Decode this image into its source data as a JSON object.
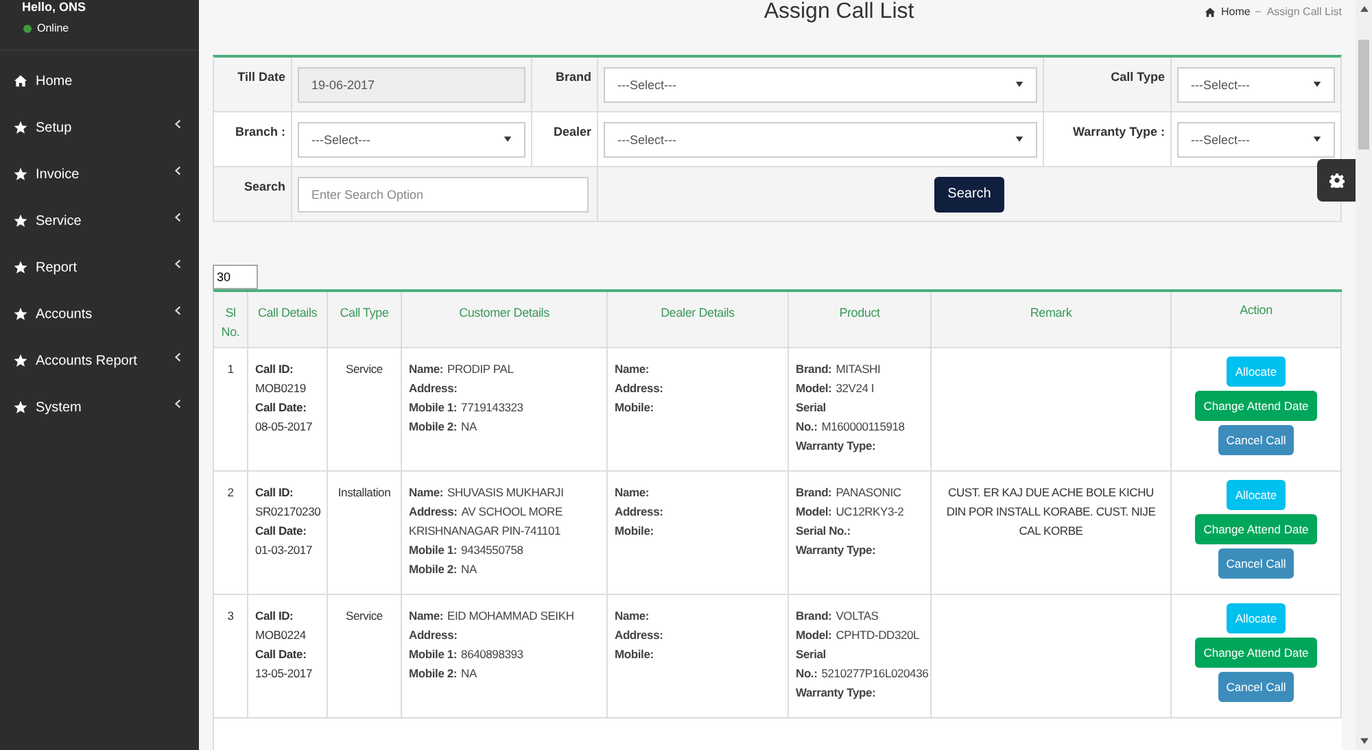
{
  "sidebar": {
    "user": "Hello, ONS",
    "status": "Online",
    "items": [
      {
        "label": "Home",
        "kind": "home",
        "expandable": false
      },
      {
        "label": "Setup",
        "kind": "star",
        "expandable": true
      },
      {
        "label": "Invoice",
        "kind": "star",
        "expandable": true
      },
      {
        "label": "Service",
        "kind": "star",
        "expandable": true
      },
      {
        "label": "Report",
        "kind": "star",
        "expandable": true
      },
      {
        "label": "Accounts",
        "kind": "star",
        "expandable": true
      },
      {
        "label": "Accounts Report",
        "kind": "star",
        "expandable": true
      },
      {
        "label": "System",
        "kind": "star",
        "expandable": true
      }
    ]
  },
  "page": {
    "title": "Assign Call List",
    "breadcrumb": [
      "Home",
      "Assign Call List"
    ]
  },
  "filter_rows": [
    [
      {
        "kind": "label",
        "text": "Till Date"
      },
      {
        "kind": "date",
        "value": "19-06-2017"
      },
      {
        "kind": "label",
        "text": "Brand"
      },
      {
        "kind": "select",
        "value": "---Select---"
      },
      {
        "kind": "label",
        "text": "Call Type"
      },
      {
        "kind": "select",
        "value": "---Select---"
      }
    ],
    [
      {
        "kind": "label",
        "text": "Branch :"
      },
      {
        "kind": "select",
        "value": "---Select---"
      },
      {
        "kind": "label",
        "text": "Dealer"
      },
      {
        "kind": "select",
        "value": "---Select---"
      },
      {
        "kind": "label",
        "text": "Warranty Type :"
      },
      {
        "kind": "select",
        "value": "---Select---"
      }
    ],
    [
      {
        "kind": "label",
        "text": "Search"
      },
      {
        "kind": "search",
        "placeholder": "Enter Search Option"
      },
      {
        "kind": "button",
        "text": "Search"
      }
    ]
  ],
  "page_size": "30",
  "table": {
    "columns": [
      "Sl No.",
      "Call Details",
      "Call Type",
      "Customer Details",
      "Dealer Details",
      "Product",
      "Remark",
      "Action"
    ],
    "rows": [
      {
        "sl": "1",
        "call": [
          {
            "label": "Call ID:",
            "value": "MOB0219"
          },
          {
            "label": "Call Date:",
            "value": "08-05-2017"
          }
        ],
        "call_type": "Service",
        "customer": [
          {
            "label": "Name:",
            "value": "PRODIP PAL"
          },
          {
            "label": "Address:"
          },
          {
            "label": "Mobile 1:",
            "value": "7719143323"
          },
          {
            "label": "Mobile 2:",
            "value": "NA"
          }
        ],
        "dealer": [
          {
            "label": "Name:"
          },
          {
            "label": "Address:"
          },
          {
            "label": "Mobile:"
          }
        ],
        "product": [
          {
            "label": "Brand:",
            "value": "MITASHI"
          },
          {
            "label": "Model:",
            "value": "32V24 I"
          },
          {
            "label": "Serial No.:",
            "value": "M160000115918"
          },
          {
            "label": "Warranty Type:"
          }
        ],
        "actions": [
          {
            "label": "Allocate",
            "kind": "allocate"
          },
          {
            "label": "Change Attend Date",
            "kind": "change"
          },
          {
            "label": "Cancel Call",
            "kind": "cancel"
          }
        ]
      },
      {
        "sl": "2",
        "call": [
          {
            "label": "Call ID:",
            "value": "SR02170230"
          },
          {
            "label": "Call Date:",
            "value": "01-03-2017"
          }
        ],
        "call_type": "Installation",
        "customer": [
          {
            "label": "Name:",
            "value": "SHUVASIS MUKHARJI"
          },
          {
            "label": "Address:",
            "value": "AV SCHOOL MORE KRISHNANAGAR PIN-741101"
          },
          {
            "label": "Mobile 1:",
            "value": "9434550758"
          },
          {
            "label": "Mobile 2:",
            "value": "NA"
          }
        ],
        "dealer": [
          {
            "label": "Name:"
          },
          {
            "label": "Address:"
          },
          {
            "label": "Mobile:"
          }
        ],
        "product": [
          {
            "label": "Brand:",
            "value": "PANASONIC"
          },
          {
            "label": "Model:",
            "value": "UC12RKY3-2"
          },
          {
            "label": "Serial No.:"
          },
          {
            "label": "Warranty Type:"
          }
        ],
        "remark": "CUST. ER KAJ DUE ACHE BOLE KICHU DIN POR INSTALL KORABE. CUST. NIJE CAL KORBE",
        "actions": [
          {
            "label": "Allocate",
            "kind": "allocate"
          },
          {
            "label": "Change Attend Date",
            "kind": "change"
          },
          {
            "label": "Cancel Call",
            "kind": "cancel"
          }
        ]
      },
      {
        "sl": "3",
        "call": [
          {
            "label": "Call ID:",
            "value": "MOB0224"
          },
          {
            "label": "Call Date:",
            "value": "13-05-2017"
          }
        ],
        "call_type": "Service",
        "customer": [
          {
            "label": "Name:",
            "value": "EID MOHAMMAD SEIKH"
          },
          {
            "label": "Address:"
          },
          {
            "label": "Mobile 1:",
            "value": "8640898393"
          },
          {
            "label": "Mobile 2:",
            "value": "NA"
          }
        ],
        "dealer": [
          {
            "label": "Name:"
          },
          {
            "label": "Address:"
          },
          {
            "label": "Mobile:"
          }
        ],
        "product": [
          {
            "label": "Brand:",
            "value": "VOLTAS"
          },
          {
            "label": "Model:",
            "value": "CPHTD-DD320L"
          },
          {
            "label": "Serial No.:",
            "value": "5210277P16L020436"
          },
          {
            "label": "Warranty Type:"
          }
        ],
        "actions": [
          {
            "label": "Allocate",
            "kind": "allocate"
          },
          {
            "label": "Change Attend Date",
            "kind": "change"
          },
          {
            "label": "Cancel Call",
            "kind": "cancel"
          }
        ]
      }
    ]
  }
}
